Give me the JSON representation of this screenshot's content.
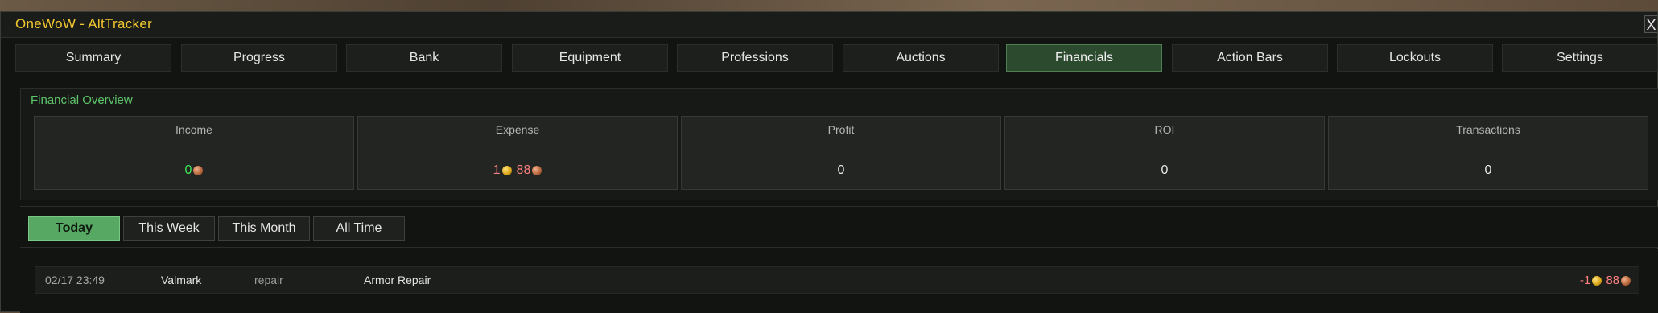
{
  "window": {
    "title": "OneWoW - AltTracker",
    "close_label": "X"
  },
  "tabs": [
    {
      "label": "Summary"
    },
    {
      "label": "Progress"
    },
    {
      "label": "Bank"
    },
    {
      "label": "Equipment"
    },
    {
      "label": "Professions"
    },
    {
      "label": "Auctions"
    },
    {
      "label": "Financials",
      "active": true
    },
    {
      "label": "Action Bars"
    },
    {
      "label": "Lockouts"
    },
    {
      "label": "Settings"
    }
  ],
  "overview": {
    "title": "Financial Overview",
    "stats": [
      {
        "label": "Income",
        "value": "0",
        "coin": "copper-icon"
      },
      {
        "label": "Expense",
        "gold": "1",
        "copper": "88"
      },
      {
        "label": "Profit",
        "value": "0"
      },
      {
        "label": "ROI",
        "value": "0"
      },
      {
        "label": "Transactions",
        "value": "0"
      }
    ]
  },
  "filters": [
    {
      "label": "Today",
      "active": true
    },
    {
      "label": "This Week"
    },
    {
      "label": "This Month"
    },
    {
      "label": "All Time"
    }
  ],
  "transactions": [
    {
      "date": "02/17 23:49",
      "character": "Valmark",
      "type": "repair",
      "description": "Armor Repair",
      "amount_prefix": "-1",
      "amount_copper": "88"
    }
  ],
  "colors": {
    "title": "#f2c830",
    "accent_green": "#5ec46a",
    "active_tab": "#2b4a2e",
    "active_filter": "#56a862",
    "income": "#3ee85a",
    "expense": "#ff8080"
  }
}
